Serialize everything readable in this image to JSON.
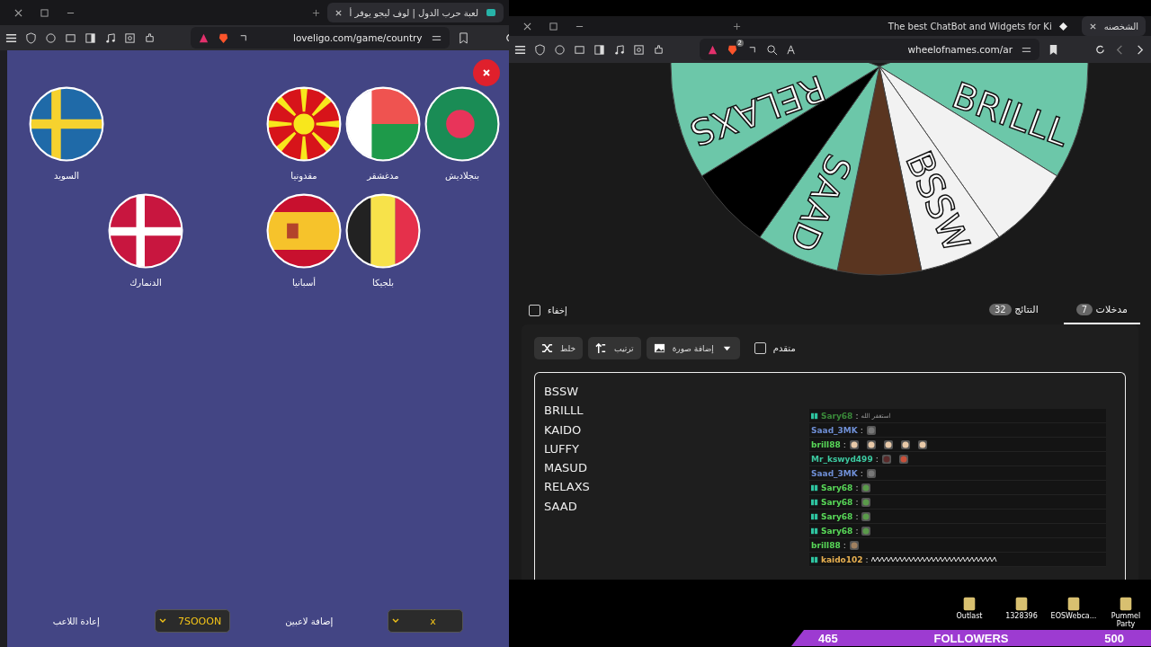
{
  "left_window": {
    "tab_title": "لعبة حرب الدول | لوف ليجو يوفر أ",
    "url": "loveligo.com/game/country"
  },
  "game": {
    "rows": [
      [
        {
          "name": "بنجلاديش",
          "kind": "bangladesh"
        },
        {
          "name": "مدغشقر",
          "kind": "madagascar"
        },
        {
          "name": "مقدونيا",
          "kind": "macedonia"
        },
        null,
        null,
        {
          "name": "السويد",
          "kind": "sweden"
        }
      ],
      [
        null,
        {
          "name": "بلجيكا",
          "kind": "belgium"
        },
        {
          "name": "أسبانيا",
          "kind": "spain"
        },
        null,
        {
          "name": "الدنمارك",
          "kind": "denmark"
        },
        null
      ]
    ],
    "controls": [
      {
        "kind": "select",
        "value": "x"
      },
      {
        "kind": "text",
        "label": "إضافة لاعبين"
      },
      {
        "kind": "select",
        "value": "7SOOON"
      },
      {
        "kind": "text",
        "label": "إعادة اللاعب"
      }
    ]
  },
  "right_window": {
    "tabs": [
      {
        "title": "الشخصنه",
        "selected": true
      },
      {
        "title": "The best ChatBot and Widgets for Ki",
        "selected": false
      }
    ],
    "url": "wheelofnames.com/ar",
    "shield_badge": "2"
  },
  "wheel": {
    "segments": [
      {
        "label": "BRILLL",
        "color": "#6cc7a9"
      },
      {
        "color": "#f2f2f2"
      },
      {
        "label": "BSSW",
        "color": "#f2f2f2"
      },
      {
        "color": "#5a3520"
      },
      {
        "label": "SAAD",
        "color": "#6cc7a9"
      },
      {
        "color": "#000000"
      },
      {
        "label": "RELAXS",
        "color": "#6cc7a9"
      }
    ]
  },
  "panel_tabs": [
    {
      "label": "مدخلات",
      "count": "7",
      "selected": true
    },
    {
      "label": "النتائج",
      "count": "32",
      "selected": false
    }
  ],
  "hide": {
    "label": "إخفاء",
    "checked": false
  },
  "toolbar": [
    {
      "kind": "image",
      "label": "إضافة صورة"
    },
    {
      "kind": "sort",
      "label": "ترتيب"
    },
    {
      "kind": "shuffle",
      "label": "خلط"
    }
  ],
  "advanced": {
    "label": "متقدم",
    "checked": false
  },
  "entries": [
    "BSSW",
    "BRILLL",
    "KAIDO",
    "LUFFY",
    "MASUD",
    "RELAXS",
    "SAAD"
  ],
  "chat": [
    {
      "user": "Sary68",
      "color": "#3a8a3a",
      "badge": true,
      "separator": ":",
      "kind": "text",
      "text": "استغفر الله"
    },
    {
      "user": "Saad_3MK",
      "color": "#6f8fd6",
      "badge": false,
      "separator": ":",
      "kind": "emote",
      "emotes": [
        {
          "kind": "cat"
        }
      ]
    },
    {
      "user": "brill88",
      "color": "#58d858",
      "badge": false,
      "separator": ":",
      "kind": "emote",
      "emotes": [
        {
          "kind": "boy"
        },
        {
          "kind": "boy"
        },
        {
          "kind": "boy"
        },
        {
          "kind": "boy"
        },
        {
          "kind": "boy"
        }
      ]
    },
    {
      "user": "Mr_kswyd499",
      "color": "#3cc9a0",
      "badge": false,
      "separator": ":",
      "kind": "emote",
      "emotes": [
        {
          "kind": "knife"
        },
        {
          "kind": "shout"
        }
      ]
    },
    {
      "user": "Saad_3MK",
      "color": "#6f8fd6",
      "badge": false,
      "separator": ":",
      "kind": "emote",
      "emotes": [
        {
          "kind": "cat"
        }
      ]
    },
    {
      "user": "Sary68",
      "color": "#58d858",
      "badge": true,
      "separator": ":",
      "kind": "emote",
      "emotes": [
        {
          "kind": "frog"
        }
      ]
    },
    {
      "user": "Sary68",
      "color": "#58d858",
      "badge": true,
      "separator": ":",
      "kind": "emote",
      "emotes": [
        {
          "kind": "frog"
        }
      ]
    },
    {
      "user": "Sary68",
      "color": "#58d858",
      "badge": true,
      "separator": ":",
      "kind": "emote",
      "emotes": [
        {
          "kind": "frog"
        }
      ]
    },
    {
      "user": "Sary68",
      "color": "#58d858",
      "badge": true,
      "separator": ":",
      "kind": "emote",
      "emotes": [
        {
          "kind": "frog"
        }
      ]
    },
    {
      "user": "brill88",
      "color": "#58d858",
      "badge": false,
      "separator": ":",
      "kind": "emote",
      "emotes": [
        {
          "kind": "pug"
        }
      ]
    },
    {
      "user": "kaido102",
      "color": "#e8b050",
      "badge": true,
      "separator": ":",
      "kind": "scribble"
    }
  ],
  "desktop_icons": [
    {
      "label": "Pummel Party"
    },
    {
      "label": "EOSWebca..."
    },
    {
      "label": "1328396"
    },
    {
      "label": "Outlast"
    }
  ],
  "followers": {
    "current": "465",
    "label": "FOLLOWERS",
    "goal": "500"
  }
}
